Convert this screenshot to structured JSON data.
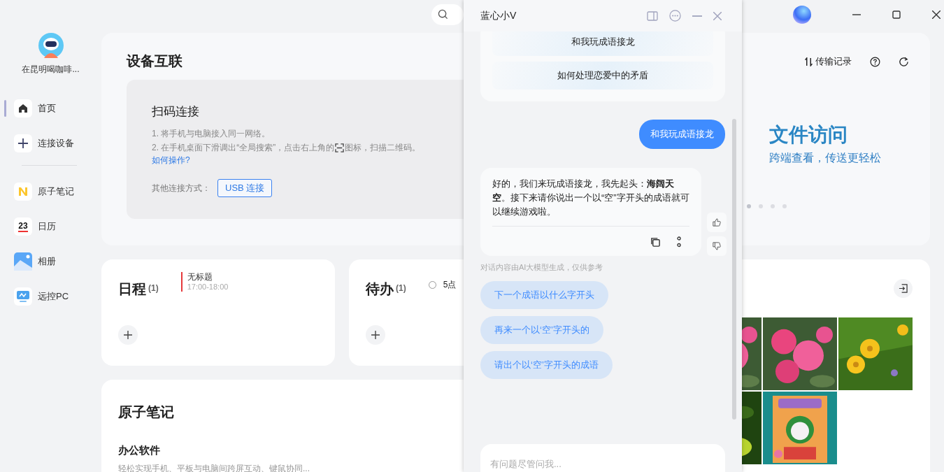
{
  "sidebar": {
    "user": {
      "name": "在昆明喝咖啡..."
    },
    "sections": [
      {
        "items": [
          {
            "label": "首页",
            "selected": true
          },
          {
            "label": "连接设备",
            "selected": false
          }
        ]
      },
      {
        "items": [
          {
            "label": "原子笔记",
            "selected": false
          },
          {
            "label": "日历",
            "icon_text": "23",
            "selected": false
          },
          {
            "label": "相册",
            "selected": false
          },
          {
            "label": "远控PC",
            "selected": false
          }
        ]
      }
    ]
  },
  "devices": {
    "title": "设备互联",
    "scan": {
      "title": "扫码连接",
      "step_1": "1. 将手机与电脑接入同一网络。",
      "step_2_before": "2. 在手机桌面下滑调出“全局搜索”，点击右上角的",
      "step_2_after": "图标，扫描二维码。",
      "help_link": "如何操作?",
      "other_label": "其他连接方式：",
      "usb_button": "USB 连接"
    },
    "transfer_link": "传输记录",
    "banner": {
      "title": "文件访问",
      "subtitle": "跨端查看，传送更轻松",
      "dots": [
        {
          "selected": true
        },
        {
          "selected": false
        },
        {
          "selected": false
        },
        {
          "selected": false
        }
      ]
    }
  },
  "schedule": {
    "title": "日程",
    "count": "(1)",
    "events": [
      {
        "title": "无标题",
        "time": "17:00-18:00"
      }
    ]
  },
  "todo": {
    "title": "待办",
    "count": "(1)",
    "items": [
      {
        "text": "5点",
        "done": false
      }
    ]
  },
  "notes": {
    "title": "原子笔记",
    "items": [
      {
        "title": "办公软件",
        "desc": "轻松实现手机、平板与电脑间跨屏互动、键鼠协同..."
      }
    ]
  },
  "chat": {
    "title": "蓝心小V",
    "suggestions": [
      "和我玩成语接龙",
      "如何处理恋爱中的矛盾"
    ],
    "messages": [
      {
        "kind": "user",
        "text": "和我玩成语接龙"
      },
      {
        "kind": "assistant",
        "text": "好的，我们来玩成语接龙，我先起头：**海阔天空**。接下来请你说出一个以“空”字开头的成语就可以继续游戏啦。"
      }
    ],
    "disclaimer": "对话内容由AI大模型生成，仅供参考",
    "follow_ups": [
      "下一个成语以什么字开头",
      "再来一个以‘空’字开头的",
      "请出个以‘空’字开头的成语"
    ],
    "input": {
      "placeholder": "有问题尽管问我..."
    }
  }
}
